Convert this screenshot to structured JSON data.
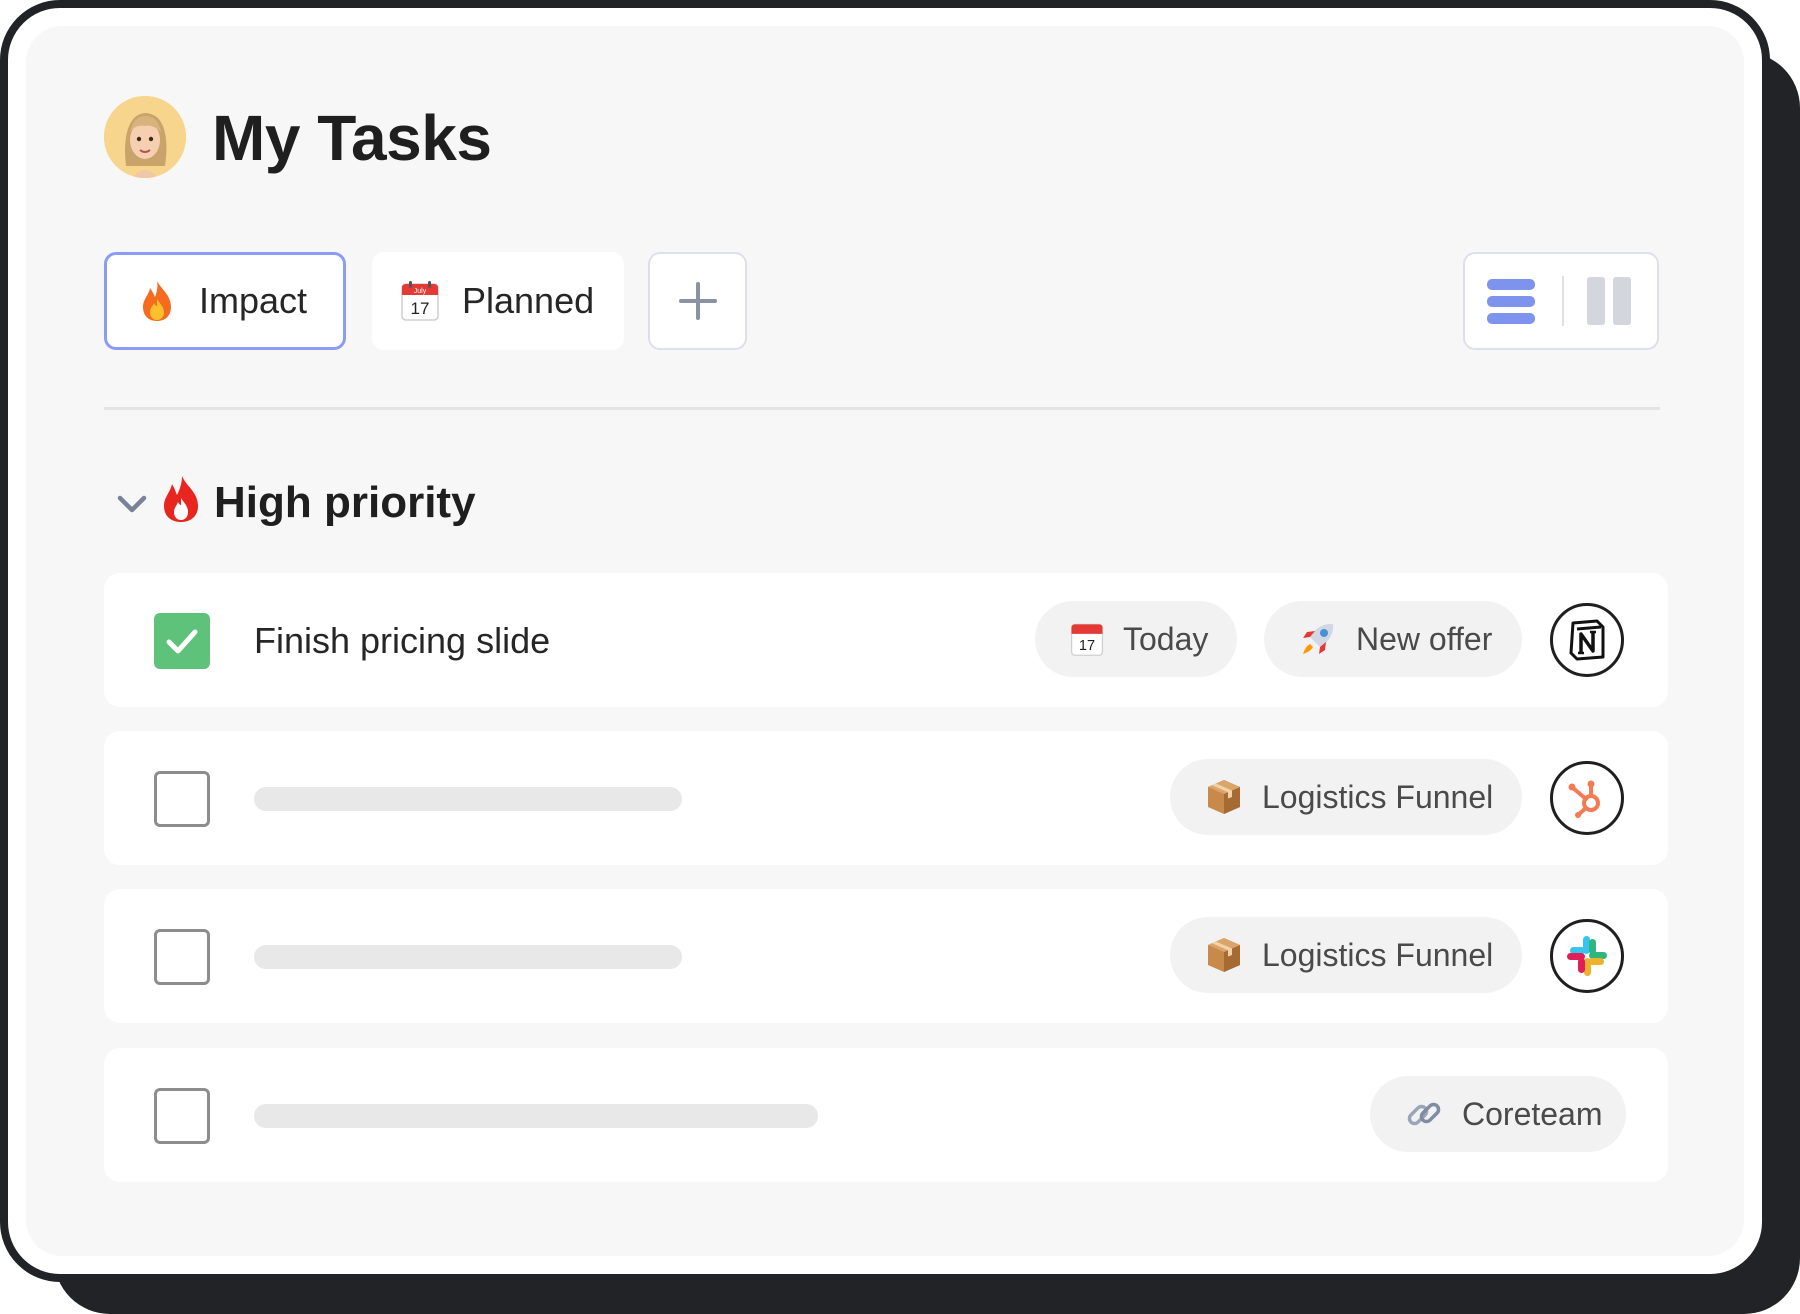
{
  "header": {
    "title": "My Tasks",
    "avatar_icon": "memoji-avatar-icon"
  },
  "tabs": [
    {
      "label": "Impact",
      "icon": "fire-icon",
      "selected": true
    },
    {
      "label": "Planned",
      "icon": "calendar-icon",
      "calendar_month": "July",
      "calendar_day": "17",
      "selected": false
    }
  ],
  "add_tab": {
    "icon": "plus-icon"
  },
  "view_toggle": {
    "options": [
      {
        "icon": "list-view-icon",
        "active": true
      },
      {
        "icon": "board-view-icon",
        "active": false
      }
    ]
  },
  "section": {
    "title": "High priority",
    "icon": "fire-icon",
    "collapse_icon": "chevron-down-icon",
    "expanded": true
  },
  "tasks": [
    {
      "title": "Finish pricing slide",
      "completed": true,
      "tags": [
        {
          "label": "Today",
          "icon": "calendar-icon"
        },
        {
          "label": "New offer",
          "icon": "rocket-icon"
        }
      ],
      "source_app_icon": "notion-icon"
    },
    {
      "title": "",
      "completed": false,
      "tags": [
        {
          "label": "Logistics Funnel",
          "icon": "package-icon"
        }
      ],
      "source_app_icon": "hubspot-icon"
    },
    {
      "title": "",
      "completed": false,
      "tags": [
        {
          "label": "Logistics Funnel",
          "icon": "package-icon"
        }
      ],
      "source_app_icon": "slack-icon"
    },
    {
      "title": "",
      "completed": false,
      "tags": [
        {
          "label": "Coreteam",
          "icon": "link-icon"
        }
      ],
      "source_app_icon": null
    }
  ],
  "colors": {
    "accent": "#8a9cf3",
    "view_active": "#7d93ee",
    "check_green": "#5ec27a",
    "hubspot_orange": "#f57a52",
    "frame": "#222326"
  }
}
